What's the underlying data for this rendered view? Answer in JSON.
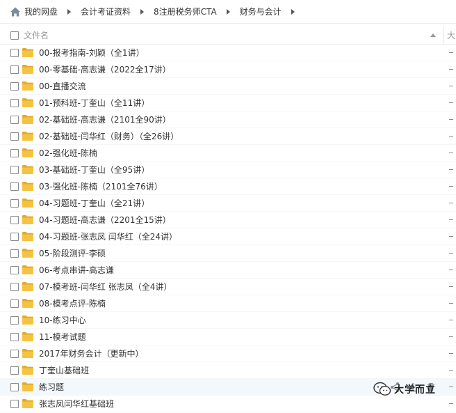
{
  "breadcrumb": {
    "items": [
      "我的网盘",
      "会计考证资料",
      "8注册税务师CTA",
      "财务与会计"
    ]
  },
  "header": {
    "name_label": "文件名",
    "size_label": "大"
  },
  "files": [
    {
      "name": "00-报考指南-刘颖（全1讲）"
    },
    {
      "name": "00-零基础-高志谦（2022全17讲）"
    },
    {
      "name": "00-直播交流"
    },
    {
      "name": "01-预科班-丁奎山（全11讲）"
    },
    {
      "name": "02-基础班-高志谦（2101全90讲）"
    },
    {
      "name": "02-基础班-闫华红（财务）（全26讲）"
    },
    {
      "name": "02-强化班-陈楠"
    },
    {
      "name": "03-基础班-丁奎山（全95讲）"
    },
    {
      "name": "03-强化班-陈楠（2101全76讲）"
    },
    {
      "name": "04-习题班-丁奎山（全21讲）"
    },
    {
      "name": "04-习题班-高志谦（2201全15讲）"
    },
    {
      "name": "04-习题班-张志凤 闫华红（全24讲）"
    },
    {
      "name": "05-阶段测评-李硕"
    },
    {
      "name": "06-考点串讲-高志谦"
    },
    {
      "name": "07-模考班-闫华红 张志凤（全4讲）"
    },
    {
      "name": "08-模考点评-陈楠"
    },
    {
      "name": "10-练习中心"
    },
    {
      "name": "11-模考试题"
    },
    {
      "name": "2017年财务会计（更新中）"
    },
    {
      "name": "丁奎山基础班"
    },
    {
      "name": "练习题"
    },
    {
      "name": "张志凤闫华红基础班"
    }
  ],
  "watermark": {
    "text": "大学而立"
  },
  "icons": {
    "home": "home-icon",
    "folder": "folder-icon",
    "share": "share-icon",
    "download": "download-icon",
    "delete": "trash-icon"
  },
  "colors": {
    "folder": "#f5c342",
    "folder_dark": "#e3ab26",
    "highlight_row": "#f3f8fd",
    "home": "#7b8a9c"
  }
}
